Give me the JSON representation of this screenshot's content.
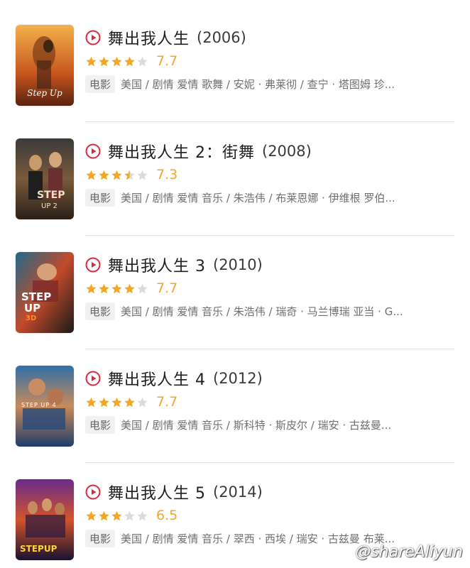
{
  "accent_color": "#e0263f",
  "star_color": "#f5a623",
  "movies": [
    {
      "title": "舞出我人生",
      "year": "(2006)",
      "stars": 4,
      "half": false,
      "score": "7.7",
      "tag": "电影",
      "meta": "美国 / 剧情 爱情 歌舞 / 安妮 · 弗莱彻 / 查宁 · 塔图姆 珍...",
      "poster_icon": "poster-step-up-2006"
    },
    {
      "title": "舞出我人生 2：街舞",
      "year": "(2008)",
      "stars": 3,
      "half": true,
      "score": "7.3",
      "tag": "电影",
      "meta": "美国 / 剧情 爱情 音乐 / 朱浩伟 / 布莱恩娜 · 伊维根 罗伯...",
      "poster_icon": "poster-step-up-2"
    },
    {
      "title": "舞出我人生 3",
      "year": "(2010)",
      "stars": 4,
      "half": false,
      "score": "7.7",
      "tag": "电影",
      "meta": "美国 / 剧情 爱情 音乐 / 朱浩伟 / 瑞奇 · 马兰博瑞 亚当 · G...",
      "poster_icon": "poster-step-up-3d"
    },
    {
      "title": "舞出我人生 4",
      "year": "(2012)",
      "stars": 4,
      "half": false,
      "score": "7.7",
      "tag": "电影",
      "meta": "美国 / 剧情 爱情 音乐 / 斯科特 · 斯皮尔 / 瑞安 · 古兹曼...",
      "poster_icon": "poster-step-up-4"
    },
    {
      "title": "舞出我人生 5",
      "year": "(2014)",
      "stars": 3,
      "half": false,
      "score": "6.5",
      "tag": "电影",
      "meta": "美国 / 剧情 爱情 音乐 / 翠西 · 西埃 / 瑞安 · 古兹曼 布莱...",
      "poster_icon": "poster-step-up-all-in"
    }
  ],
  "watermark": "@shareAliyun"
}
